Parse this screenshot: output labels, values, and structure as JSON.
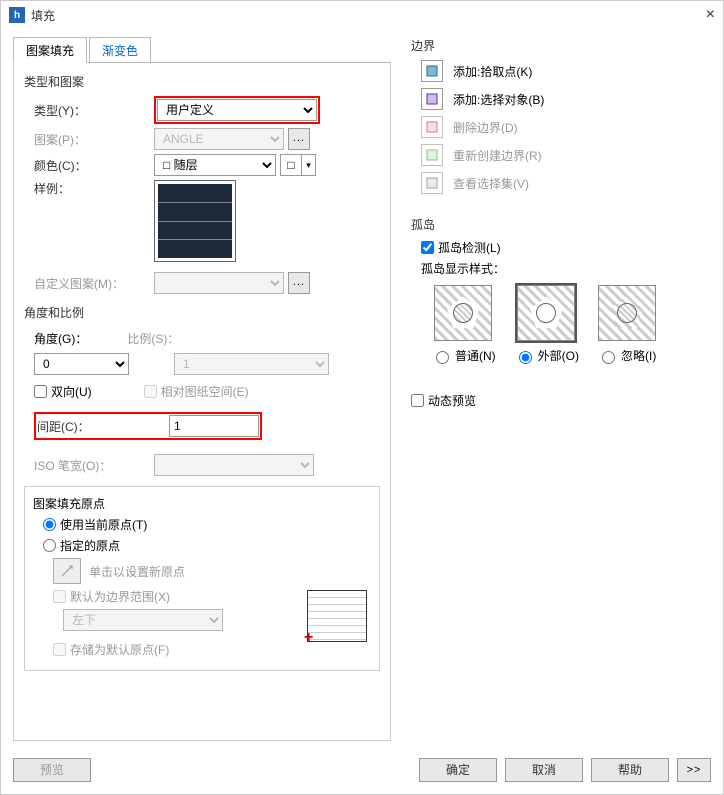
{
  "window": {
    "title": "填充",
    "close_glyph": "×"
  },
  "tabs": {
    "pattern": "图案填充",
    "gradient": "渐变色"
  },
  "typePattern": {
    "section": "类型和图案",
    "type_label": "类型(Y)：",
    "type_value": "用户定义",
    "pattern_label": "图案(P)：",
    "pattern_value": "ANGLE",
    "color_label": "颜色(C)：",
    "color_value": "随层",
    "square_glyph": "□",
    "swatch_arrow": "▾",
    "sample_label": "样例：",
    "custom_label": "自定义图案(M)：",
    "custom_value": "",
    "ellipsis": "..."
  },
  "angleScale": {
    "section": "角度和比例",
    "angle_label": "角度(G)：",
    "angle_value": "0",
    "scale_label": "比例(S)：",
    "scale_value": "1",
    "double_label": "双向(U)",
    "relpaper_label": "相对图纸空间(E)",
    "spacing_label": "间距(C)：",
    "spacing_value": "1",
    "isopen_label": "ISO 笔宽(O)：",
    "isopen_value": ""
  },
  "origin": {
    "section": "图案填充原点",
    "use_current": "使用当前原点(T)",
    "specify": "指定的原点",
    "click_set": "单击以设置新原点",
    "default_bound": "默认为边界范围(X)",
    "pos_value": "左下",
    "store_default": "存储为默认原点(F)"
  },
  "boundary": {
    "section": "边界",
    "add_pick": "添加:拾取点(K)",
    "add_select": "添加:选择对象(B)",
    "delete": "删除边界(D)",
    "recreate": "重新创建边界(R)",
    "view": "查看选择集(V)"
  },
  "island": {
    "section": "孤岛",
    "detect": "孤岛检测(L)",
    "style_label": "孤岛显示样式：",
    "normal": "普通(N)",
    "outer": "外部(O)",
    "ignore": "忽略(I)"
  },
  "dynamic_preview": "动态预览",
  "footer": {
    "preview": "预览",
    "ok": "确定",
    "cancel": "取消",
    "help": "帮助",
    "expand": ">>"
  }
}
